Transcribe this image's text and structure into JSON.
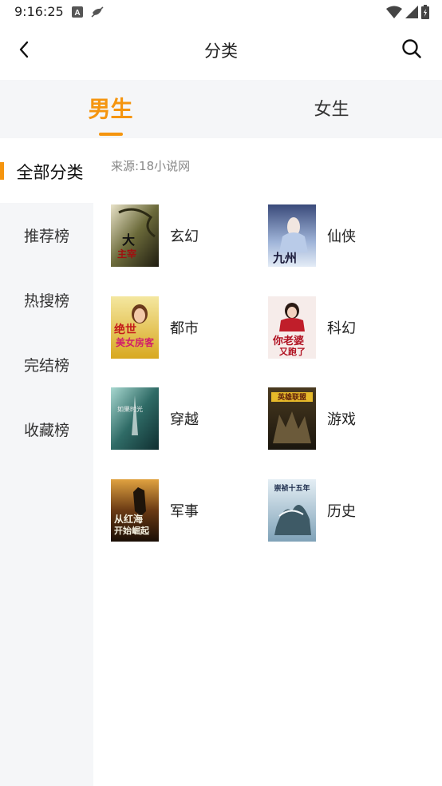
{
  "status_bar": {
    "time": "9:16:25",
    "left_icons": [
      "app-a-icon",
      "no-signal-bird-icon"
    ],
    "right_icons": [
      "wifi-icon",
      "cell-signal-icon",
      "battery-icon"
    ]
  },
  "top_bar": {
    "title": "分类",
    "back_icon": "chevron-left-icon",
    "search_icon": "search-icon"
  },
  "gender_tabs": [
    {
      "label": "男生",
      "active": true
    },
    {
      "label": "女生",
      "active": false
    }
  ],
  "sidebar": {
    "items": [
      {
        "label": "全部分类",
        "active": true
      },
      {
        "label": "推荐榜",
        "active": false
      },
      {
        "label": "热搜榜",
        "active": false
      },
      {
        "label": "完结榜",
        "active": false
      },
      {
        "label": "收藏榜",
        "active": false
      }
    ]
  },
  "content": {
    "source": "来源:18小说网",
    "categories": [
      {
        "name": "玄幻",
        "cover_title": "大主宰"
      },
      {
        "name": "仙侠",
        "cover_title": "九州图"
      },
      {
        "name": "都市",
        "cover_title": "绝世美女房客"
      },
      {
        "name": "科幻",
        "cover_title": "你老婆又跑了"
      },
      {
        "name": "穿越",
        "cover_title": "如果时光才好色"
      },
      {
        "name": "游戏",
        "cover_title": "英雄联盟"
      },
      {
        "name": "军事",
        "cover_title": "从红海开始崛起"
      },
      {
        "name": "历史",
        "cover_title": "崇祯十五年"
      }
    ]
  },
  "colors": {
    "accent": "#f5950f",
    "sidebar_bg": "#f5f6f8",
    "text": "#222222",
    "muted": "#888888"
  }
}
